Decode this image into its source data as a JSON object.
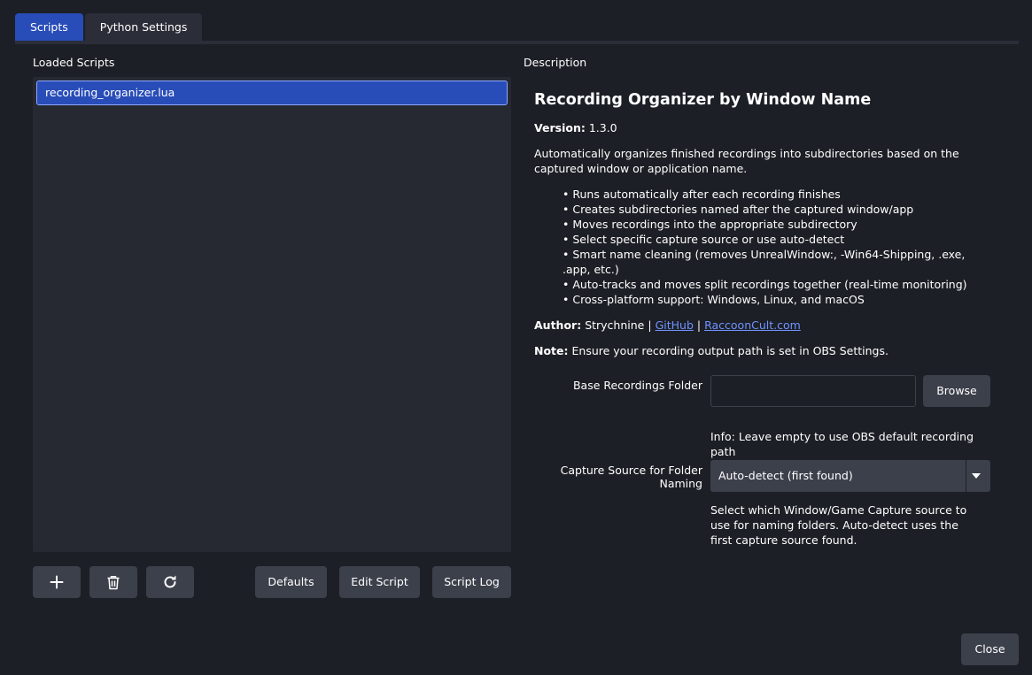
{
  "tabs": [
    {
      "label": "Scripts"
    },
    {
      "label": "Python Settings"
    }
  ],
  "loaded_scripts": {
    "label": "Loaded Scripts",
    "items": [
      "recording_organizer.lua"
    ]
  },
  "toolbar": {
    "add_icon": "plus-icon",
    "remove_icon": "trash-icon",
    "reload_icon": "refresh-icon",
    "defaults_label": "Defaults",
    "edit_label": "Edit Script",
    "log_label": "Script Log"
  },
  "description": {
    "label": "Description",
    "title": "Recording Organizer by Window Name",
    "version_label": "Version:",
    "version": "1.3.0",
    "summary": "Automatically organizes finished recordings into subdirectories based on the captured window or application name.",
    "features": [
      "Runs automatically after each recording finishes",
      "Creates subdirectories named after the captured window/app",
      "Moves recordings into the appropriate subdirectory",
      "Select specific capture source or use auto-detect",
      "Smart name cleaning (removes UnrealWindow:, -Win64-Shipping, .exe, .app, etc.)",
      "Auto-tracks and moves split recordings together (real-time monitoring)",
      "Cross-platform support: Windows, Linux, and macOS"
    ],
    "author_label": "Author:",
    "author": "Strychnine",
    "separator": "|",
    "link_github": "GitHub",
    "link_site": "RaccoonCult.com",
    "note_label": "Note:",
    "note": "Ensure your recording output path is set in OBS Settings."
  },
  "properties": {
    "folder_label": "Base Recordings Folder",
    "folder_value": "",
    "browse_label": "Browse",
    "folder_info": "Info: Leave empty to use OBS default recording path",
    "source_label": "Capture Source for Folder Naming",
    "source_value": "Auto-detect (first found)",
    "source_help": "Select which Window/Game Capture source to use for naming folders. Auto-detect uses the first capture source found."
  },
  "close_label": "Close",
  "colors": {
    "background": "#1d1f26",
    "panel": "#262932",
    "button": "#3c404b",
    "accent": "#284cb8",
    "link": "#6f93ff"
  }
}
